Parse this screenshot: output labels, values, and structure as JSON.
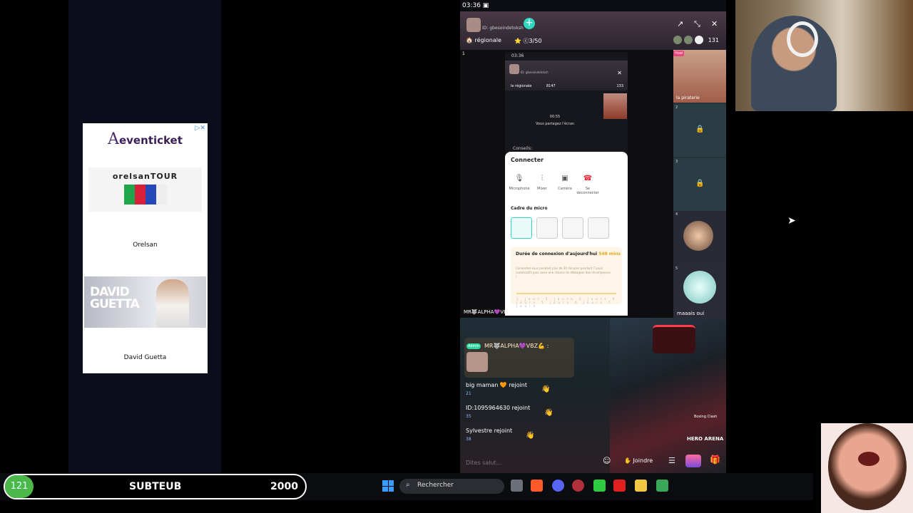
{
  "left_ad": {
    "brand": "eventicket",
    "banner1_text": "orelsanTOUR",
    "item1_label": "Orelsan",
    "banner2_title": "DAVID GUETTA",
    "item2_label": "David Guetta"
  },
  "phone": {
    "status_time": "03:36",
    "host_id": "ID: gbesoindetoksh",
    "region_label": "régionale",
    "rank_value": "3/50",
    "viewer_count": "131",
    "slots": [
      {
        "num": "1",
        "tag": "Host",
        "name": "la piraterie"
      },
      {
        "num": "2",
        "locked": true
      },
      {
        "num": "3",
        "locked": true
      },
      {
        "num": "4"
      },
      {
        "num": "5",
        "name": "maaais oui"
      }
    ],
    "inner": {
      "status_time": "03:36",
      "host_id": "ID: gbesoindetoksh",
      "region_label": "le régionale",
      "rank_value": "8147",
      "viewer_count": "133",
      "share_time": "00:55",
      "share_text": "Vous partagez l'écran",
      "conseils_label": "Conseils:",
      "sheet_title": "Connecter",
      "buttons": [
        "Microphone",
        "Mixer",
        "Caméra",
        "Se déconnecter"
      ],
      "frame_section": "Cadre du micro",
      "conn_title": "Durée de connexion d'aujourd'hui",
      "conn_value": "548 mins",
      "conn_desc": "Connectez-vous pendant plus de 30 minutes pendant 7 jours consécutifs pour avoir une chance de débloquer des récompenses !",
      "days": [
        "1 jour",
        "2 jours",
        "3 jours",
        "4 jours",
        "5 jours",
        "6 jours",
        "7 jours"
      ]
    },
    "under_label": "MR🐺ALPHA💜VBZ",
    "chat": {
      "message_badge": "Admin",
      "message_sender": "MR🐺ALPHA💜VBZ💪 :",
      "joins": [
        {
          "name": "big maman 🧡 rejoint",
          "level": "21"
        },
        {
          "name": "ID:1095964630 rejoint",
          "level": "35"
        },
        {
          "name": "Sylvestre rejoint",
          "level": "38"
        }
      ],
      "input_placeholder": "Dites salut...",
      "join_button": "Joindre",
      "boxing_label": "Boxing Clash",
      "hero_label": "HERO ARENA"
    }
  },
  "taskbar": {
    "search_placeholder": "Rechercher"
  },
  "sub_goal": {
    "count": "121",
    "label": "SUBTEUB",
    "goal": "2000"
  }
}
